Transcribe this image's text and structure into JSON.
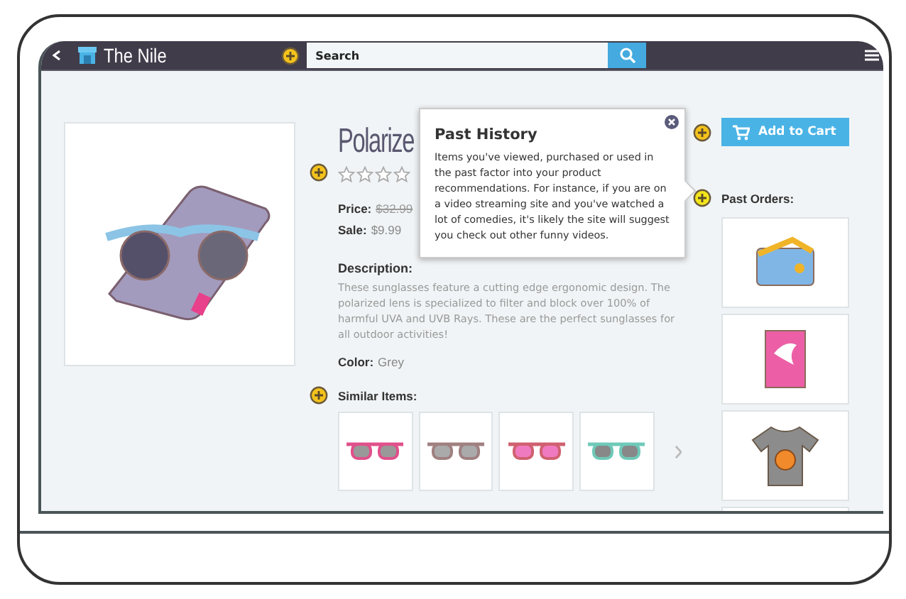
{
  "nav": {
    "title": "The Nile",
    "search": {
      "placeholder": "Search"
    }
  },
  "product": {
    "title": "Polarize",
    "stars": 0,
    "price_label": "Price:",
    "price": "$32.99",
    "sale_label": "Sale:",
    "sale": "$9.99",
    "description_label": "Description:",
    "description": "These sunglasses feature a cutting edge ergonomic design. The polarized lens is specialized to filter and block over 100% of harmful UVA and UVB Rays. These are the perfect sunglasses for all outdoor activities!",
    "color_label": "Color:",
    "color_name": "Grey"
  },
  "similar_items": {
    "heading": "Similar Items:",
    "items": [
      {
        "kind": "pink-sunglasses"
      },
      {
        "kind": "aviator-sunglasses"
      },
      {
        "kind": "round-sunglasses"
      },
      {
        "kind": "teal-sunglasses"
      }
    ]
  },
  "cart_button": "Add to Cart",
  "past_orders": {
    "heading": "Past Orders:",
    "items": [
      {
        "kind": "bag"
      },
      {
        "kind": "book"
      },
      {
        "kind": "shirt"
      },
      {
        "kind": "partial"
      }
    ]
  },
  "popover": {
    "title": "Past History",
    "text": "Items you've viewed, purchased or used in the past factor into your product recommendations. For instance, if you are on a video streaming site and you've watched a lot of comedies, it's likely the site will suggest you check out other funny videos."
  }
}
